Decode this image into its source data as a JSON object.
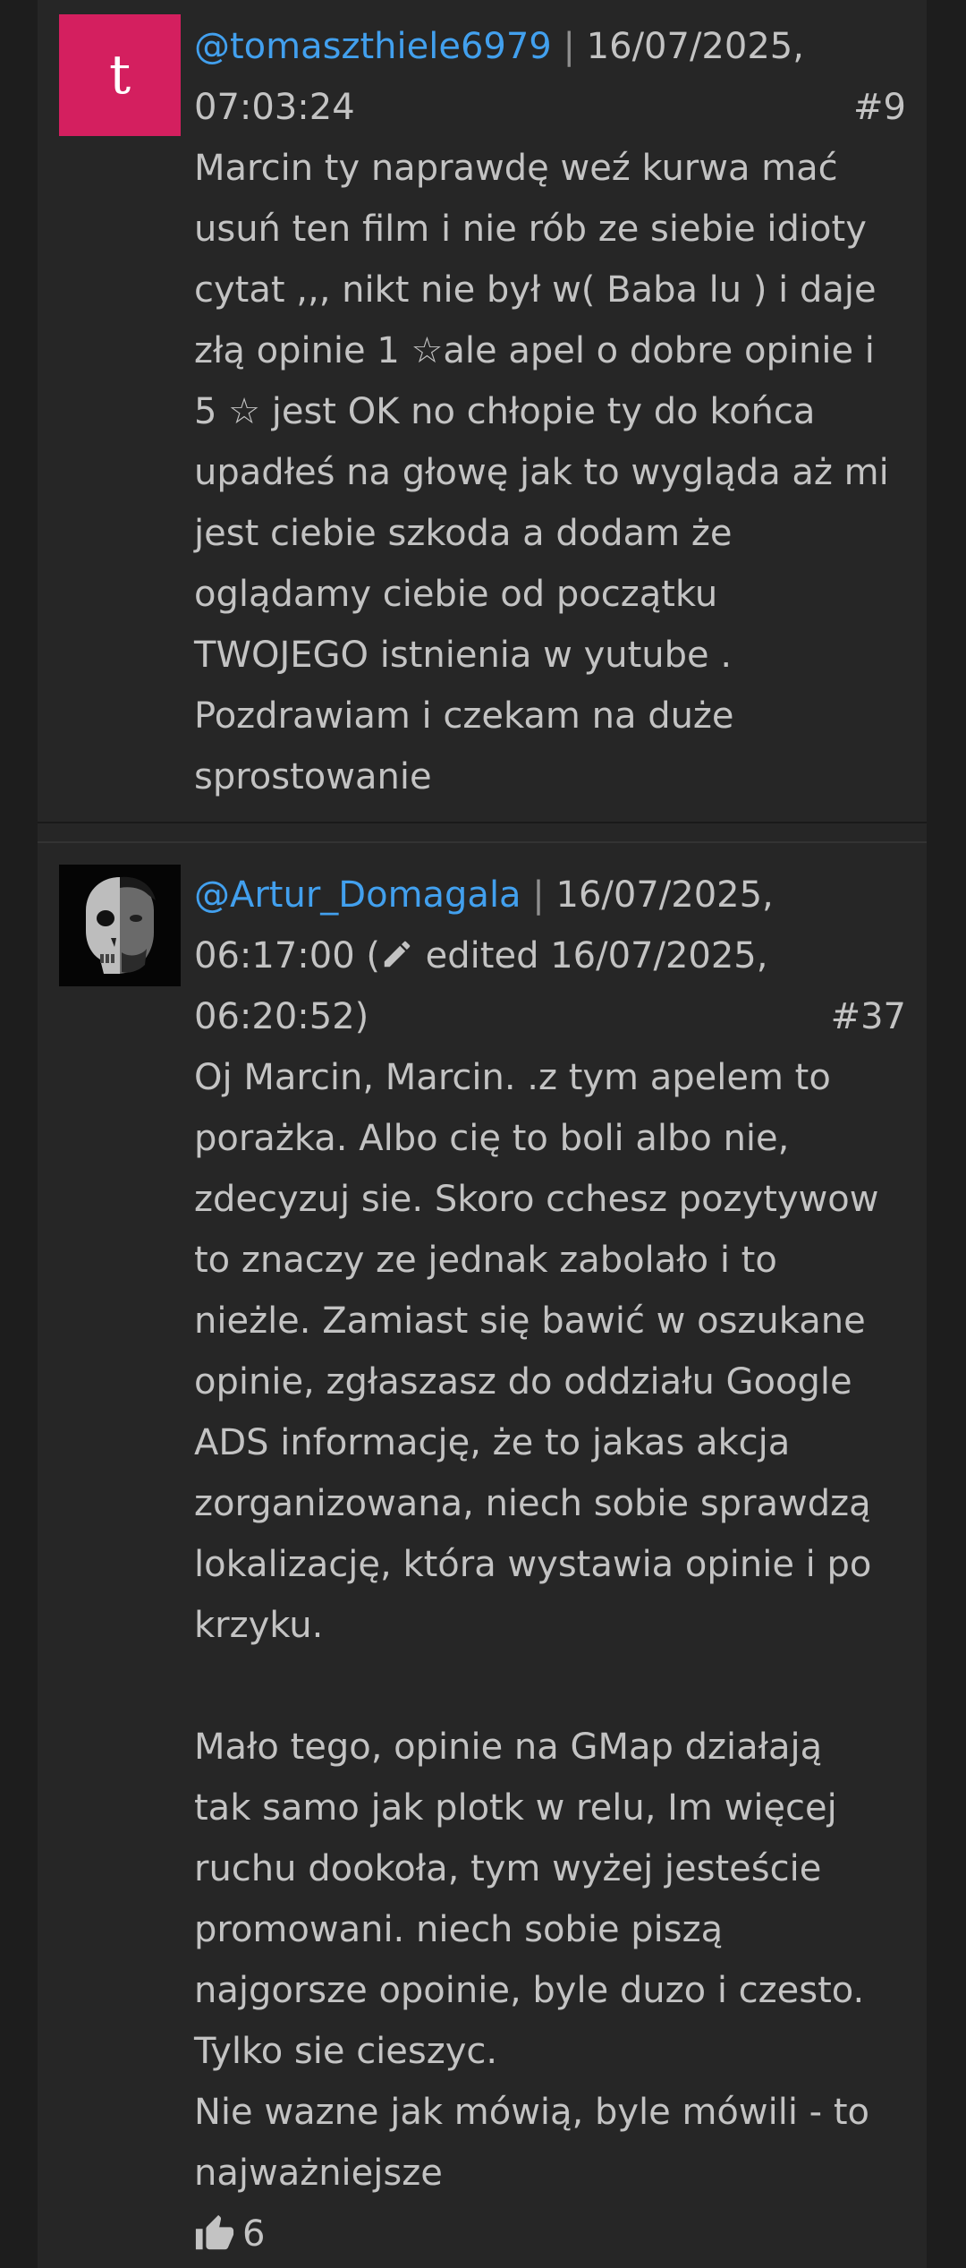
{
  "comments": [
    {
      "avatar_letter": "t",
      "avatar_color": "#d41f5f",
      "username": "@tomaszthiele6979",
      "separator": "|",
      "timestamp_date": "16/07/2025,",
      "timestamp_time": "07:03:24",
      "number": "#9",
      "lines": [
        "Marcin ty naprawdę weź kurwa mać",
        "usuń ten film i nie rób ze siebie idioty",
        "cytat ,,, nikt nie był w( Baba lu ) i daje",
        "złą opinie 1 ☆ale apel o dobre opinie i",
        "5 ☆ jest OK no chłopie ty do końca",
        "upadłeś na głowę jak to wygląda aż mi",
        "jest ciebie szkoda a dodam że",
        "oglądamy ciebie od początku",
        "TWOJEGO istnienia w yutube .",
        "Pozdrawiam i czekam na duże",
        "sprostowanie"
      ]
    },
    {
      "avatar_icon": "skull-portrait-avatar",
      "username": "@Artur_Domagala",
      "separator": "|",
      "timestamp_date": "16/07/2025,",
      "timestamp_time": "06:17:00 (",
      "edited_text": " edited 16/07/2025,",
      "edited_time": "06:20:52)",
      "number": "#37",
      "paragraph1": [
        "Oj Marcin, Marcin. .z tym apelem to",
        "porażka. Albo cię to boli albo nie,",
        "zdecyzuj sie. Skoro cchesz pozytywow",
        "to znaczy ze jednak zabolało i to",
        "nieżle. Zamiast się bawić w oszukane",
        "opinie, zgłaszasz do oddziału Google",
        "ADS informację, że to jakas akcja",
        "zorganizowana, niech sobie sprawdzą",
        "lokalizację, która wystawia opinie i po",
        "krzyku."
      ],
      "paragraph2": [
        "Mało tego, opinie na GMap działają",
        "tak samo jak plotk w relu, Im więcej",
        "ruchu dookoła, tym wyżej jesteście",
        "promowani. niech sobie piszą",
        "najgorsze opoinie, byle duzo i czesto.",
        "Tylko sie cieszyc.",
        "Nie wazne jak mówią, byle mówili - to",
        "najważniejsze"
      ],
      "likes": "6"
    }
  ],
  "colors": {
    "background": "#1d1d1d",
    "panel": "#262626",
    "text": "#c3c3c3",
    "username": "#42a0ee"
  },
  "icons": {
    "edit": "pencil-icon",
    "like": "thumbs-up-icon"
  }
}
